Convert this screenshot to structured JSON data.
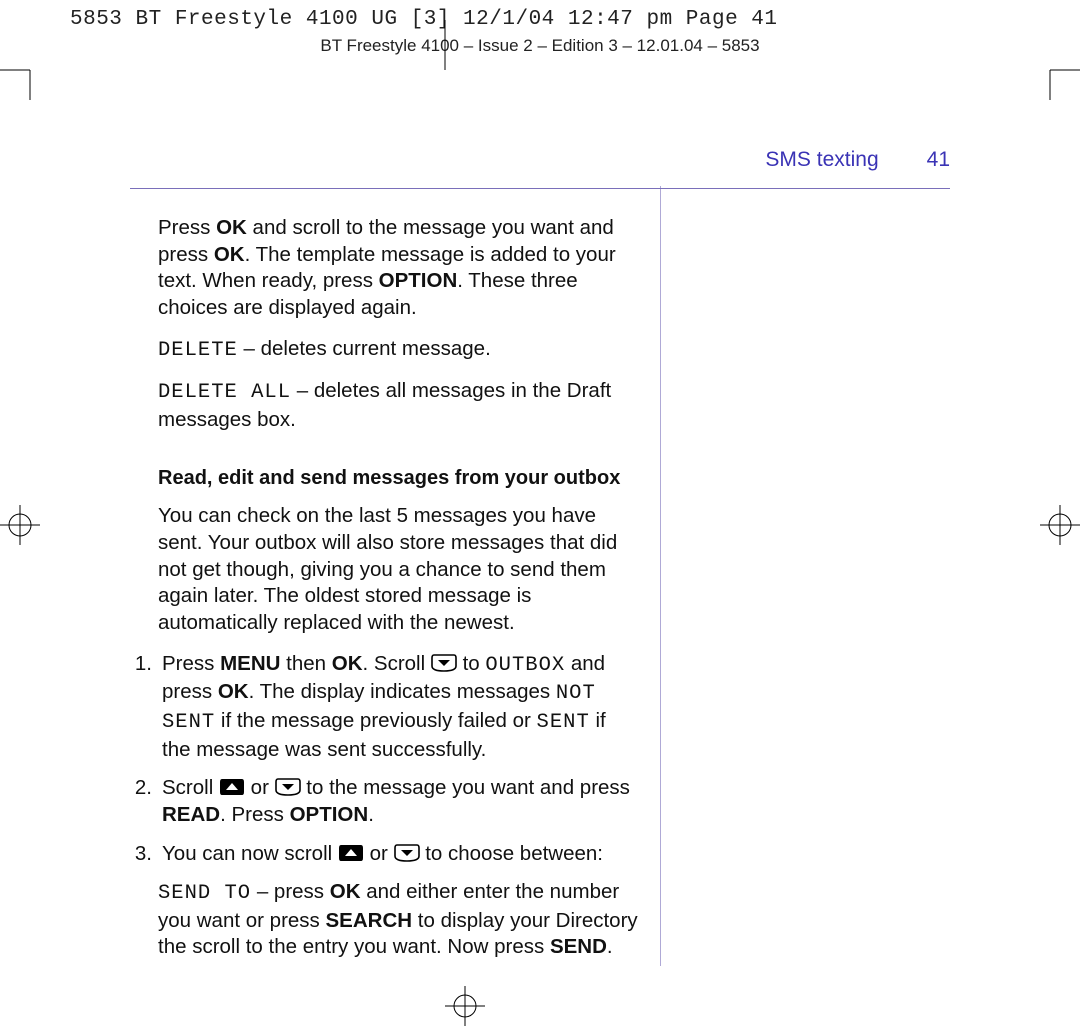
{
  "slug": "5853 BT Freestyle 4100 UG [3]  12/1/04  12:47 pm  Page 41",
  "header_line": "BT Freestyle 4100 – Issue 2 – Edition 3 – 12.01.04 – 5853",
  "section": {
    "title": "SMS texting",
    "page": "41"
  },
  "p1": {
    "t1": "Press ",
    "ok1": "OK",
    "t2": " and scroll to the message you want and press ",
    "ok2": "OK",
    "t3": ". The template message is added to your text. When ready, press ",
    "opt": "OPTION",
    "t4": ". These three choices are displayed again."
  },
  "p2": {
    "lcd": "DELETE",
    "rest": " – deletes current message."
  },
  "p3": {
    "lcd": "DELETE ALL",
    "rest": " – deletes all messages in the Draft messages box."
  },
  "h4": "Read, edit and send messages from your outbox",
  "p4": "You can check on the last 5 messages you have sent. Your outbox will also store messages that did not get though, giving you a chance to send them again later. The oldest stored message is automatically replaced with the newest.",
  "li1": {
    "num": "1.",
    "t1": "Press ",
    "menu": "MENU",
    "t2": " then ",
    "ok": "OK",
    "t3": ". Scroll ",
    "t4": " to ",
    "outbox": "OUTBOX",
    "t5": " and press ",
    "ok2": "OK",
    "t6": ". The display indicates messages ",
    "notsent": "NOT SENT",
    "t7": " if the message previously failed or ",
    "sent": "SENT",
    "t8": " if the message was sent successfully."
  },
  "li2": {
    "num": "2.",
    "t1": "Scroll ",
    "t2": " or ",
    "t3": " to the message you want and press ",
    "read": "READ",
    "t4": ". Press ",
    "opt": "OPTION",
    "t5": "."
  },
  "li3": {
    "num": "3.",
    "t1": "You can now scroll ",
    "t2": " or ",
    "t3": " to choose between:"
  },
  "p5": {
    "lcd": "SEND TO",
    "t1": " – press ",
    "ok": "OK",
    "t2": " and either enter the number you want or press ",
    "search": "SEARCH",
    "t3": " to display your Directory the scroll to the entry you want. Now press ",
    "send": "SEND",
    "t4": "."
  }
}
